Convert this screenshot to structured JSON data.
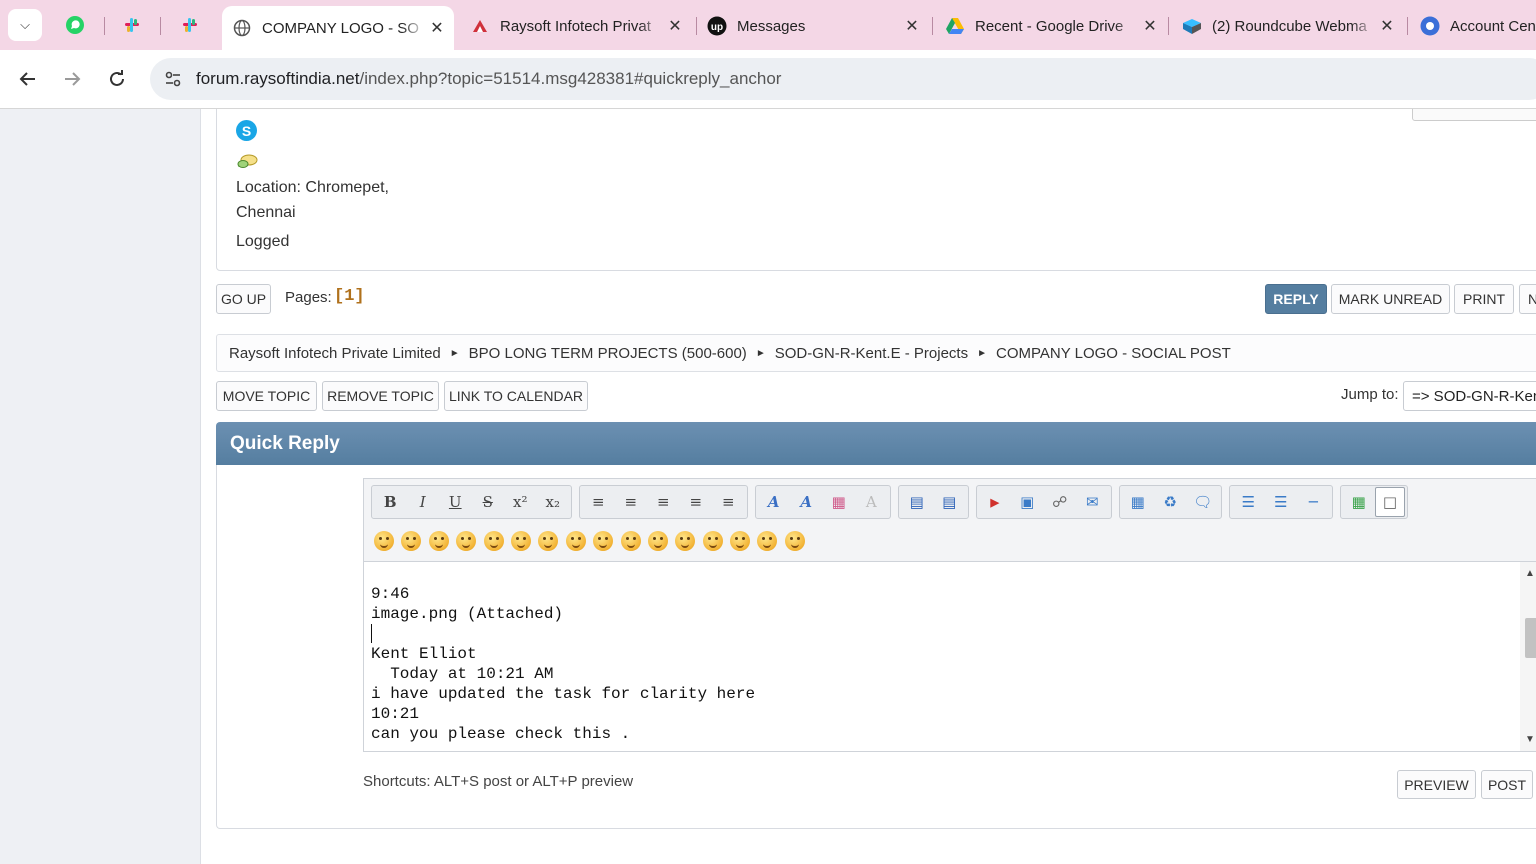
{
  "browser": {
    "tabs": [
      {
        "title": "COMPANY LOGO - SO",
        "icon": "globe-icon"
      },
      {
        "title": "Raysoft Infotech Privat",
        "icon": "raysoft-icon"
      },
      {
        "title": "Messages",
        "icon": "upwork-icon"
      },
      {
        "title": "Recent - Google Drive",
        "icon": "google-drive-icon"
      },
      {
        "title": "(2) Roundcube Webma",
        "icon": "roundcube-icon"
      },
      {
        "title": "Account Cen",
        "icon": "account-icon"
      }
    ],
    "url_host": "forum.raysoftindia.net",
    "url_path": "/index.php?topic=51514.msg428381#quickreply_anchor"
  },
  "post": {
    "location_line1": "Location: Chromepet,",
    "location_line2": "Chennai",
    "logged": "Logged"
  },
  "pagination": {
    "go_up": "GO UP",
    "pages_label": "Pages:",
    "pages_value": "[1]",
    "actions": {
      "reply": "REPLY",
      "mark_unread": "MARK UNREAD",
      "print": "PRINT",
      "next": "N"
    }
  },
  "breadcrumb": [
    "Raysoft Infotech Private Limited",
    "BPO LONG TERM PROJECTS (500-600)",
    "SOD-GN-R-Kent.E - Projects",
    "COMPANY LOGO - SOCIAL POST"
  ],
  "moderation": {
    "move_topic": "MOVE TOPIC",
    "remove_topic": "REMOVE TOPIC",
    "link_to_calendar": "LINK TO CALENDAR",
    "jump_label": "Jump to:",
    "jump_value": "=> SOD-GN-R-Kent"
  },
  "quick_reply": {
    "title": "Quick Reply",
    "editor_lines": [
      "9:46",
      "image.png (Attached)",
      "",
      "Kent Elliot",
      "  Today at 10:21 AM",
      "i have updated the task for clarity here",
      "10:21",
      "can you please check this ."
    ],
    "shortcuts": "Shortcuts: ALT+S post or ALT+P preview",
    "preview": "PREVIEW",
    "post": "POST"
  },
  "colors": {
    "tab_strip": "#f4d7e6",
    "header_blue": "#557ea0",
    "pages_accent": "#b0711c"
  }
}
